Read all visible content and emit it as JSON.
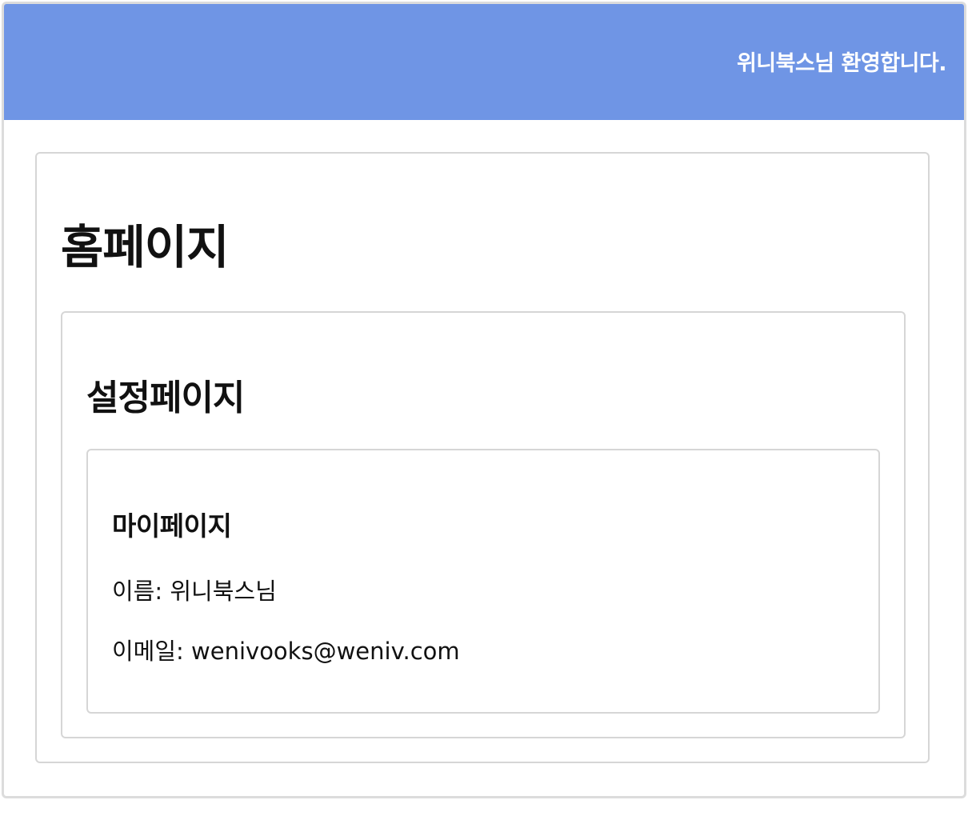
{
  "header": {
    "welcome_text": "위니북스님 환영합니다."
  },
  "home": {
    "title": "홈페이지"
  },
  "settings": {
    "title": "설정페이지"
  },
  "mypage": {
    "title": "마이페이지",
    "name_line": "이름: 위니북스님",
    "email_line": "이메일: wenivooks@weniv.com"
  },
  "colors": {
    "header_background": "#6f95e5",
    "header_text": "#ffffff",
    "card_border": "#d6d6d6",
    "page_background": "#ffffff"
  }
}
